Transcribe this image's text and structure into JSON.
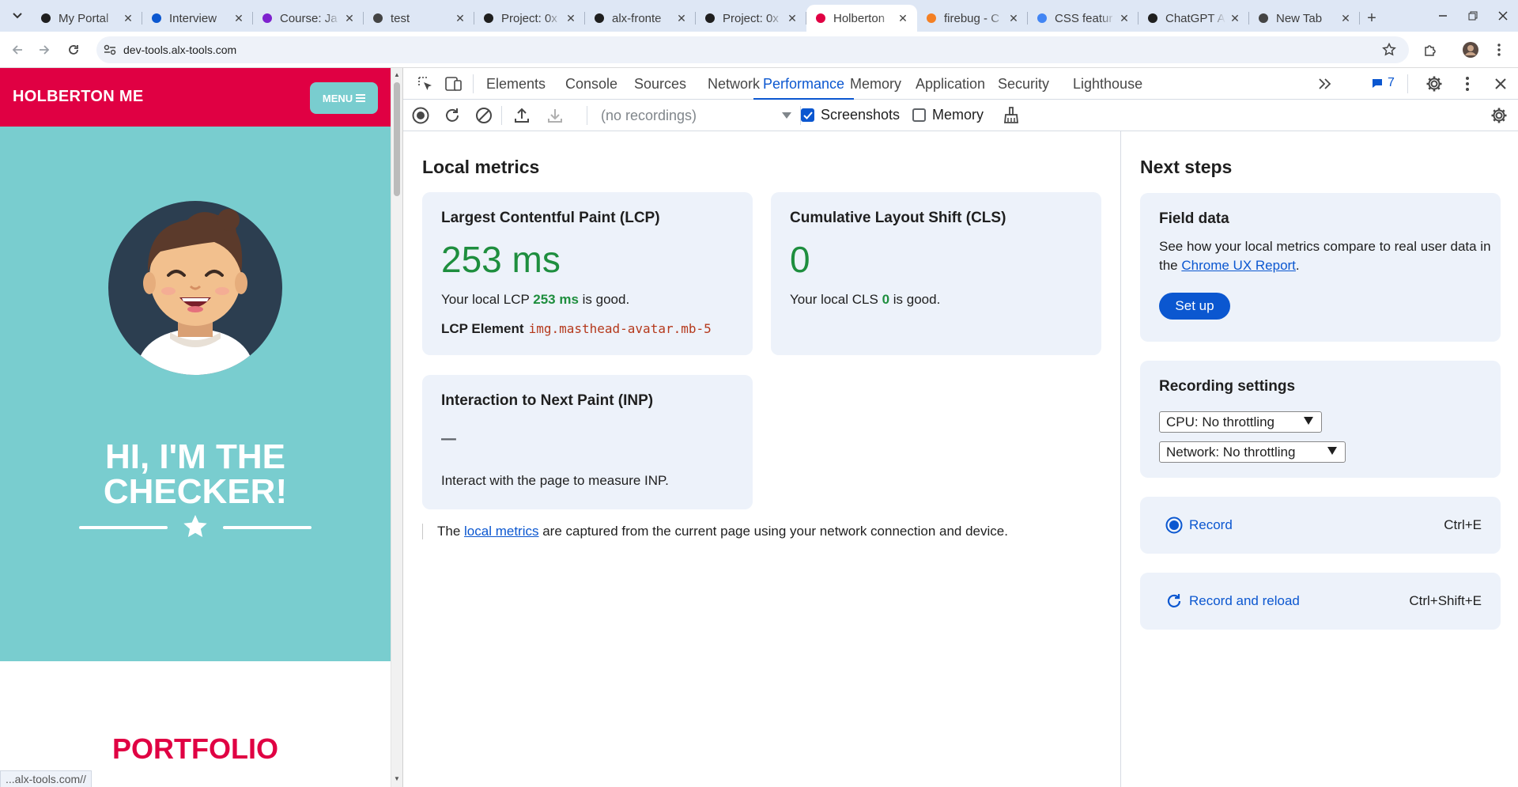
{
  "browser": {
    "tabs": [
      {
        "title": "My Portal",
        "favicon": "alx-icon",
        "color": "#1f1f1f"
      },
      {
        "title": "Interview",
        "favicon": "chrome-c-icon",
        "color": "#0b57d0"
      },
      {
        "title": "Course: Ja",
        "favicon": "course-icon",
        "color": "#7e22ce"
      },
      {
        "title": "test",
        "favicon": "globe-icon",
        "color": "#444444"
      },
      {
        "title": "Project: 0x",
        "favicon": "alx-icon",
        "color": "#1f1f1f"
      },
      {
        "title": "alx-fronte",
        "favicon": "github-icon",
        "color": "#1f1f1f"
      },
      {
        "title": "Project: 0x",
        "favicon": "alx-icon",
        "color": "#1f1f1f"
      },
      {
        "title": "Holberton",
        "favicon": "holberton-icon",
        "color": "#e00043",
        "active": true
      },
      {
        "title": "firebug - C",
        "favicon": "stackoverflow-icon",
        "color": "#f48024"
      },
      {
        "title": "CSS featur",
        "favicon": "google-icon",
        "color": "#4285f4"
      },
      {
        "title": "ChatGPT A",
        "favicon": "chatgpt-icon",
        "color": "#1f1f1f"
      },
      {
        "title": "New Tab",
        "favicon": "globe-icon",
        "color": "#444444"
      }
    ],
    "url": "dev-tools.alx-tools.com"
  },
  "page": {
    "brand": "HOLBERTON ME",
    "menu_label": "MENU",
    "title_line1": "HI, I'M THE",
    "title_line2": "CHECKER!",
    "portfolio": "PORTFOLIO",
    "status_url": "...alx-tools.com//"
  },
  "devtools": {
    "tabs": [
      "Elements",
      "Console",
      "Sources",
      "Network",
      "Performance",
      "Memory",
      "Application",
      "Security",
      "Lighthouse"
    ],
    "active_tab": "Performance",
    "issues_count": "7",
    "recordings_placeholder": "(no recordings)",
    "screenshots_label": "Screenshots",
    "memory_label": "Memory",
    "screenshots_checked": true,
    "memory_checked": false
  },
  "local_metrics": {
    "heading": "Local metrics",
    "lcp": {
      "title": "Largest Contentful Paint (LCP)",
      "value": "253 ms",
      "desc_prefix": "Your local LCP ",
      "desc_value": "253 ms",
      "desc_suffix": " is good.",
      "element_label": "LCP Element",
      "element_value": "img.masthead-avatar.mb-5"
    },
    "cls": {
      "title": "Cumulative Layout Shift (CLS)",
      "value": "0",
      "desc_prefix": "Your local CLS ",
      "desc_value": "0",
      "desc_suffix": " is good."
    },
    "inp": {
      "title": "Interaction to Next Paint (INP)",
      "value": "–",
      "desc": "Interact with the page to measure INP."
    },
    "footnote_prefix": "The ",
    "footnote_link": "local metrics",
    "footnote_suffix": " are captured from the current page using your network connection and device."
  },
  "next_steps": {
    "heading": "Next steps",
    "field_data": {
      "title": "Field data",
      "desc_prefix": "See how your local metrics compare to real user data in the ",
      "desc_link": "Chrome UX Report",
      "desc_suffix": ".",
      "button": "Set up"
    },
    "recording_settings": {
      "title": "Recording settings",
      "cpu": "CPU: No throttling",
      "network": "Network: No throttling"
    },
    "record": {
      "label": "Record",
      "shortcut": "Ctrl+E"
    },
    "record_reload": {
      "label": "Record and reload",
      "shortcut": "Ctrl+Shift+E"
    }
  },
  "colors": {
    "holberton_red": "#e00043",
    "teal": "#79cdcf",
    "good_green": "#1e8e3e",
    "link_blue": "#0b57d0",
    "card_bg": "#edf2fa"
  }
}
